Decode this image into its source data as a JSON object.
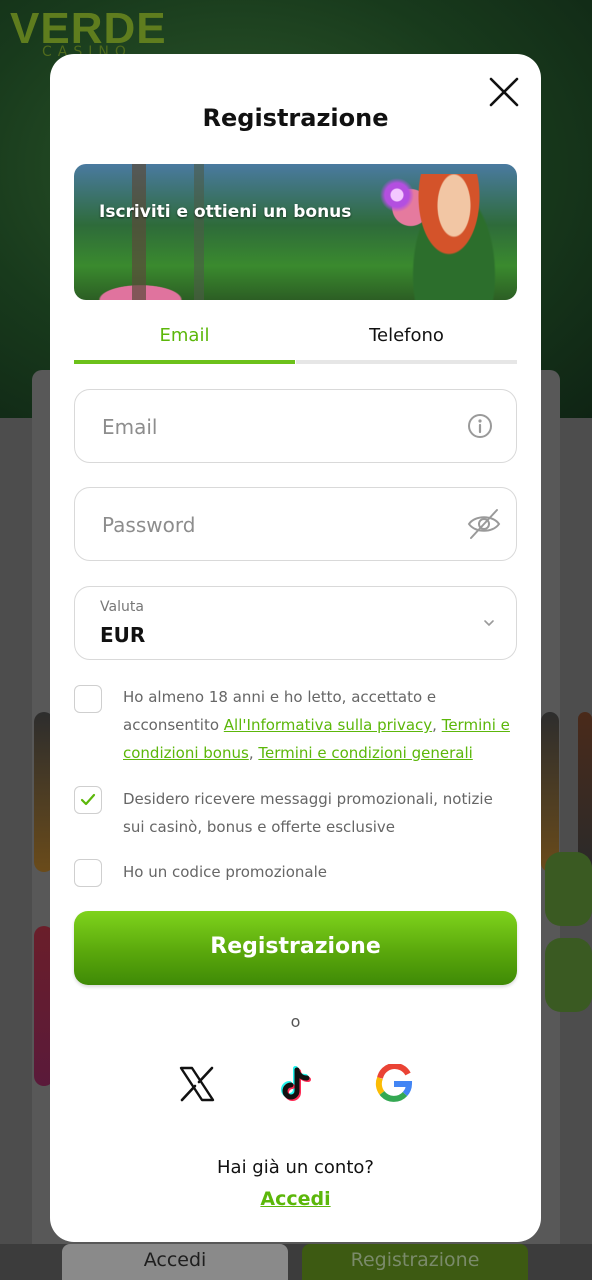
{
  "background": {
    "logo": "VERDE",
    "logo_sub": "CASINO",
    "bottom_login": "Accedi",
    "bottom_register": "Registrazione"
  },
  "modal": {
    "title": "Registrazione",
    "banner_text": "Iscriviti e ottieni un bonus",
    "tabs": [
      {
        "label": "Email",
        "active": true
      },
      {
        "label": "Telefono",
        "active": false
      }
    ],
    "email": {
      "placeholder": "Email",
      "value": ""
    },
    "password": {
      "placeholder": "Password",
      "value": ""
    },
    "currency": {
      "label": "Valuta",
      "value": "EUR"
    },
    "terms": {
      "checked": false,
      "text_before": "Ho almeno 18 anni e ho letto, accettato e acconsentito ",
      "link_privacy": "All'Informativa sulla privacy",
      "sep1": ", ",
      "link_bonus": "Termini e condizioni bonus",
      "sep2": ", ",
      "link_general": "Termini e condizioni generali"
    },
    "promo_messages": {
      "checked": true,
      "text": "Desidero ricevere messaggi promozionali, notizie sui casinò, bonus e offerte esclusive"
    },
    "promo_code": {
      "checked": false,
      "text": "Ho un codice promozionale"
    },
    "submit_label": "Registrazione",
    "divider_text": "o",
    "social": [
      "x-icon",
      "tiktok-icon",
      "google-icon"
    ],
    "have_account": "Hai già un conto?",
    "login_link": "Accedi"
  },
  "colors": {
    "accent": "#6cc11a",
    "link": "#5cb70a",
    "button_top": "#7fd31c",
    "button_bottom": "#3f8a06"
  }
}
